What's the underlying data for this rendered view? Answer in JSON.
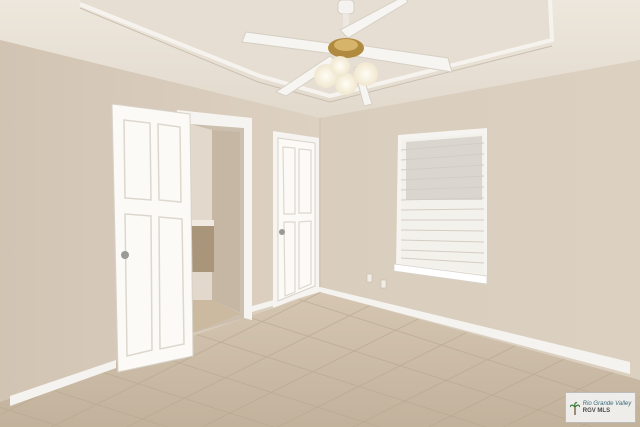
{
  "scene": {
    "description_tags": [
      "ceiling-fan",
      "open-door",
      "closet-door",
      "window-with-blinds",
      "tile-floor",
      "tray-ceiling"
    ]
  },
  "watermark": {
    "line1": "Rio Grande Valley",
    "line2": "RGV MLS",
    "icon": "palm-tree-icon"
  },
  "colors": {
    "wall": "#d8cbbb",
    "ceiling": "#e9e2d7",
    "trim": "#f4f2ee",
    "floor": "#c9b9a4"
  }
}
